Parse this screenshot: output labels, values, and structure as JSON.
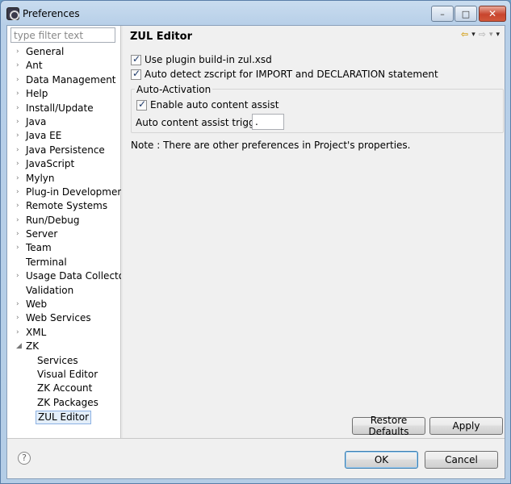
{
  "window": {
    "title": "Preferences",
    "minimize_glyph": "–",
    "maximize_glyph": "□",
    "close_glyph": "✕"
  },
  "sidebar": {
    "filter_placeholder": "type filter text",
    "items": [
      {
        "label": "General",
        "arrow": "›"
      },
      {
        "label": "Ant",
        "arrow": "›"
      },
      {
        "label": "Data Management",
        "arrow": "›"
      },
      {
        "label": "Help",
        "arrow": "›"
      },
      {
        "label": "Install/Update",
        "arrow": "›"
      },
      {
        "label": "Java",
        "arrow": "›"
      },
      {
        "label": "Java EE",
        "arrow": "›"
      },
      {
        "label": "Java Persistence",
        "arrow": "›"
      },
      {
        "label": "JavaScript",
        "arrow": "›"
      },
      {
        "label": "Mylyn",
        "arrow": "›"
      },
      {
        "label": "Plug-in Development",
        "arrow": "›"
      },
      {
        "label": "Remote Systems",
        "arrow": "›"
      },
      {
        "label": "Run/Debug",
        "arrow": "›"
      },
      {
        "label": "Server",
        "arrow": "›"
      },
      {
        "label": "Team",
        "arrow": "›"
      },
      {
        "label": "Terminal",
        "arrow": ""
      },
      {
        "label": "Usage Data Collector",
        "arrow": "›"
      },
      {
        "label": "Validation",
        "arrow": ""
      },
      {
        "label": "Web",
        "arrow": "›"
      },
      {
        "label": "Web Services",
        "arrow": "›"
      },
      {
        "label": "XML",
        "arrow": "›"
      },
      {
        "label": "ZK",
        "arrow": "◢"
      }
    ],
    "zk_children": [
      "Services",
      "Visual Editor",
      "ZK Account",
      "ZK Packages",
      "ZUL Editor"
    ],
    "selected": "ZUL Editor"
  },
  "main": {
    "title": "ZUL Editor",
    "nav": {
      "back": "⇦",
      "forward": "⇨",
      "dropdown": "▾"
    },
    "use_plugin_label": "Use plugin build-in zul.xsd",
    "auto_detect_label": "Auto detect zscript for IMPORT and DECLARATION statement",
    "auto_activation_title": "Auto-Activation",
    "enable_assist_label": "Enable auto content assist",
    "triggers_label": "Auto content assist triggers",
    "triggers_value": ".",
    "note": "Note : There are other preferences in Project's properties.",
    "restore_defaults": "Restore Defaults",
    "apply": "Apply"
  },
  "footer": {
    "help_glyph": "?",
    "ok": "OK",
    "cancel": "Cancel"
  }
}
